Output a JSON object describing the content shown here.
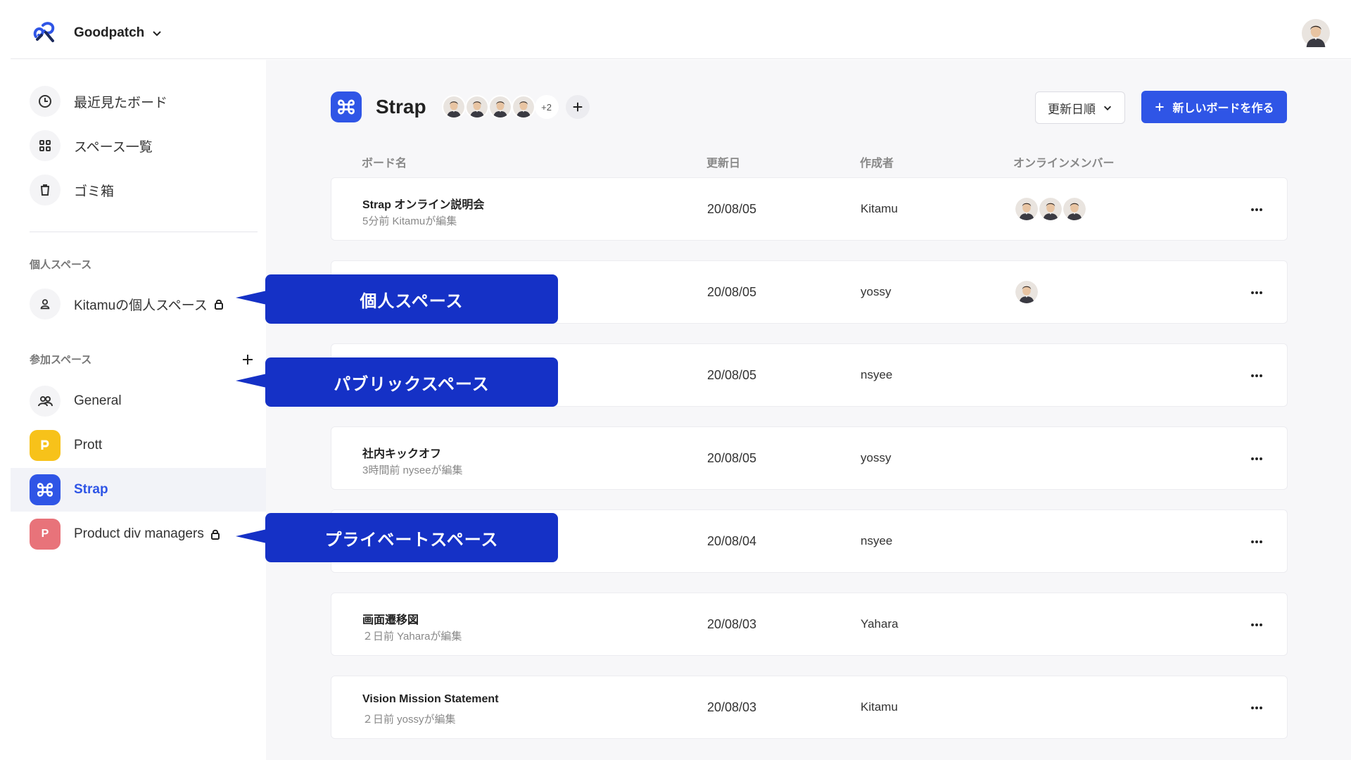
{
  "header": {
    "org_name": "Goodpatch",
    "icons": [
      "goodpatch-logo",
      "chevron-down-icon",
      "user-avatar"
    ]
  },
  "sidebar": {
    "nav": [
      {
        "label": "最近見たボード",
        "icon": "clock-icon"
      },
      {
        "label": "スペース一覧",
        "icon": "grid-icon"
      },
      {
        "label": "ゴミ箱",
        "icon": "trash-icon"
      }
    ],
    "personal_section_label": "個人スペース",
    "personal_space": {
      "label": "Kitamuの個人スペース",
      "icon": "user-icon",
      "locked": true
    },
    "joined_section_label": "参加スペース",
    "spaces": [
      {
        "label": "General",
        "icon": "users-icon",
        "color": "#f4f4f6"
      },
      {
        "label": "Prott",
        "icon": "prott-logo",
        "color": "#f7c21a"
      },
      {
        "label": "Strap",
        "icon": "strap-logo",
        "color": "#2f55e6",
        "active": true
      },
      {
        "label": "Product div managers",
        "icon": "P",
        "color": "#e8737a",
        "locked": true
      }
    ]
  },
  "space": {
    "title": "Strap",
    "extra_members": "+2",
    "sort_label": "更新日順",
    "new_board_label": "新しいボードを作る"
  },
  "table": {
    "columns": {
      "name": "ボード名",
      "updated": "更新日",
      "creator": "作成者",
      "online": "オンラインメンバー"
    },
    "rows": [
      {
        "name": "Strap オンライン説明会",
        "sub": "5分前 Kitamuが編集",
        "date": "20/08/05",
        "creator": "Kitamu",
        "online": 3
      },
      {
        "name": "",
        "sub": "",
        "date": "20/08/05",
        "creator": "yossy",
        "online": 1
      },
      {
        "name": "",
        "sub": "",
        "date": "20/08/05",
        "creator": "nsyee",
        "online": 0
      },
      {
        "name": "社内キックオフ",
        "sub": "3時間前 nyseeが編集",
        "date": "20/08/05",
        "creator": "yossy",
        "online": 0
      },
      {
        "name": "",
        "sub": "",
        "date": "20/08/04",
        "creator": "nsyee",
        "online": 0
      },
      {
        "name": "画面遷移図",
        "sub": "２日前 Yaharaが編集",
        "date": "20/08/03",
        "creator": "Yahara",
        "online": 0
      },
      {
        "name": "Vision Mission Statement",
        "sub": "２日前 yossyが編集",
        "date": "20/08/03",
        "creator": "Kitamu",
        "online": 0
      }
    ]
  },
  "callouts": {
    "personal": "個人スペース",
    "public": "パブリックスペース",
    "private": "プライベートスペース"
  },
  "colors": {
    "accent": "#2f55e6",
    "callout": "#1531c6"
  }
}
